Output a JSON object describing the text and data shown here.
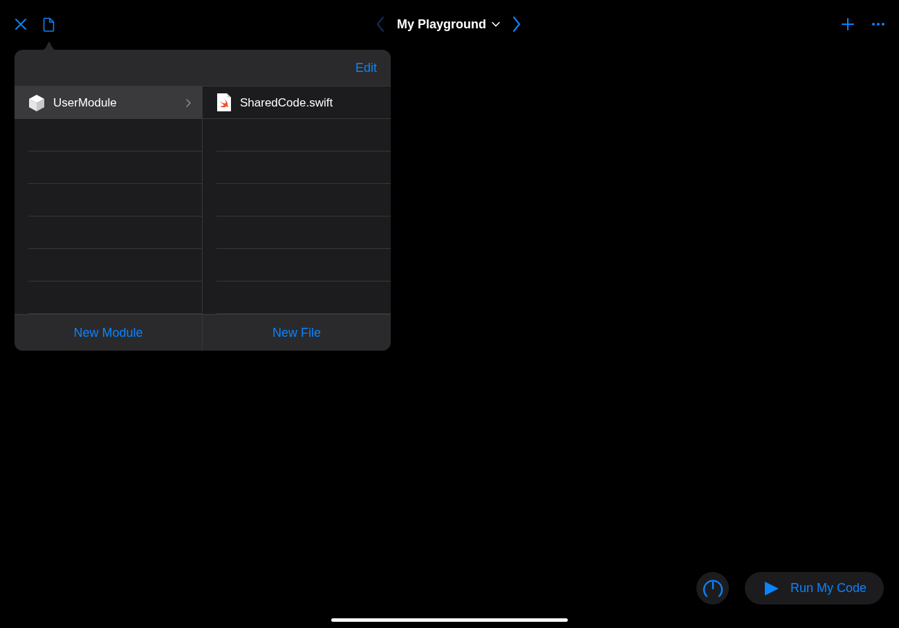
{
  "toolbar": {
    "title": "My Playground",
    "prev": {
      "disabled": true
    },
    "next": {
      "disabled": false
    }
  },
  "popover": {
    "edit_label": "Edit",
    "modules": [
      {
        "name": "UserModule",
        "selected": true
      }
    ],
    "files": [
      {
        "name": "SharedCode.swift",
        "selected": false
      }
    ],
    "footer": [
      "New Module",
      "New File"
    ]
  },
  "run_button": {
    "label": "Run My Code"
  }
}
